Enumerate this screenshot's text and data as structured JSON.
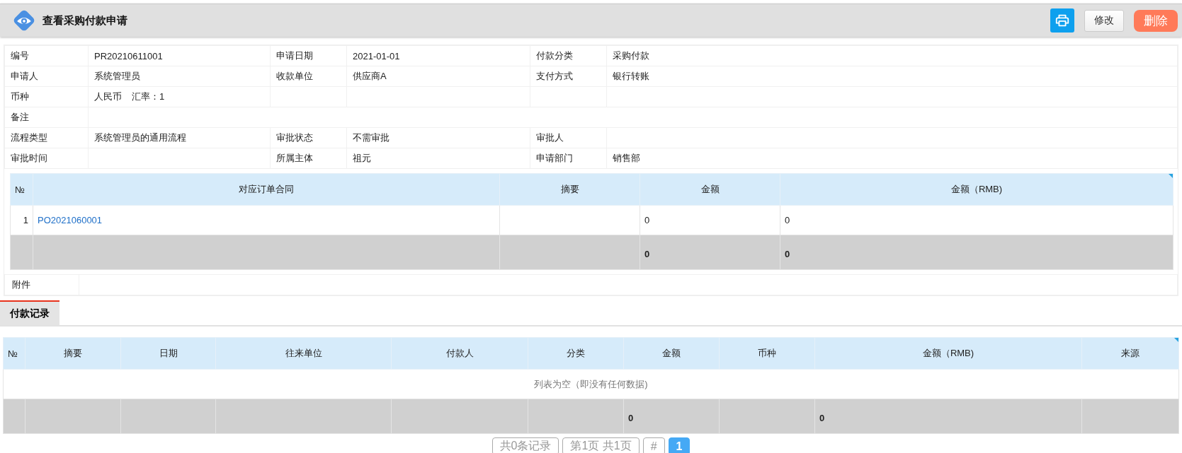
{
  "header": {
    "title": "查看采购付款申请",
    "buttons": [
      {
        "kind": "print"
      },
      {
        "kind": "edit",
        "label": "修改"
      },
      {
        "kind": "delete",
        "label": "删除"
      }
    ]
  },
  "info_rows": [
    [
      {
        "label": "编号",
        "values": [
          "PR20210611001"
        ]
      },
      {
        "label": "申请日期",
        "values": [
          "2021-01-01"
        ]
      },
      {
        "label": "付款分类",
        "values": [
          "采购付款"
        ]
      }
    ],
    [
      {
        "label": "申请人",
        "values": [
          "系统管理员"
        ]
      },
      {
        "label": "收款单位",
        "values": [
          "供应商A"
        ]
      },
      {
        "label": "支付方式",
        "values": [
          "银行转账"
        ]
      }
    ],
    [
      {
        "label": "币种",
        "values": [
          "人民币",
          "汇率：1"
        ]
      },
      {},
      {}
    ],
    [
      {
        "label": "备注",
        "kind": "wide"
      }
    ],
    [
      {
        "label": "流程类型",
        "values": [
          "系统管理员的通用流程"
        ]
      },
      {
        "label": "审批状态",
        "values": [
          "不需审批"
        ]
      },
      {
        "label": "审批人"
      }
    ],
    [
      {
        "label": "审批时间"
      },
      {
        "label": "所属主体",
        "values": [
          "祖元"
        ]
      },
      {
        "label": "申请部门",
        "values": [
          "销售部"
        ]
      }
    ]
  ],
  "orders_table": {
    "columns": [
      "№",
      "对应订单合同",
      "摘要",
      "金额",
      "金额（RMB)"
    ],
    "rows": [
      {
        "no": "1",
        "order": "PO2021060001",
        "amount": "0",
        "amount_rmb": "0"
      }
    ],
    "totals": {
      "amount": "0",
      "amount_rmb": "0"
    }
  },
  "attachment": {
    "label": "附件"
  },
  "tabs": [
    {
      "label": "付款记录",
      "selected": true
    }
  ],
  "payments_table": {
    "columns": [
      "№",
      "摘要",
      "日期",
      "往来单位",
      "付款人",
      "分类",
      "金额",
      "币种",
      "金额（RMB)",
      "来源"
    ],
    "empty_text": "列表为空（即没有任何数据)",
    "totals": {
      "amount": "0",
      "amount_rmb": "0"
    }
  },
  "pagination": {
    "items": [
      {
        "label": "共0条记录",
        "selected": false
      },
      {
        "label": "第1页 共1页",
        "selected": false
      },
      {
        "label": "#",
        "selected": false
      },
      {
        "label": "1",
        "selected": true
      }
    ]
  }
}
